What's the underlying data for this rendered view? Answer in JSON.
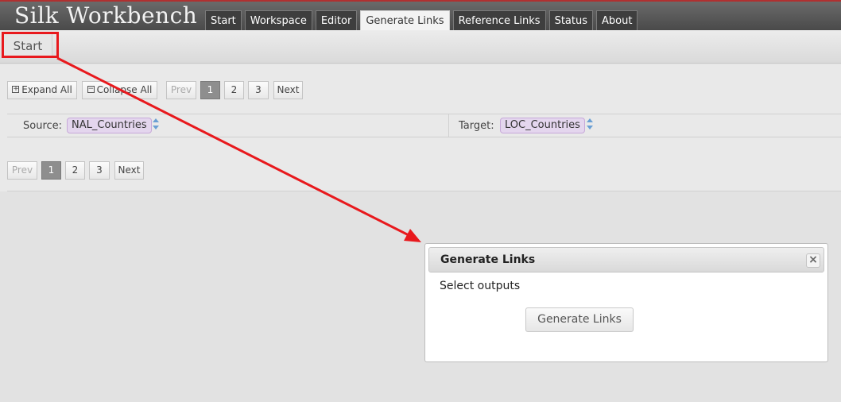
{
  "header": {
    "title": "Silk Workbench",
    "tabs": [
      "Start",
      "Workspace",
      "Editor",
      "Generate Links",
      "Reference Links",
      "Status",
      "About"
    ],
    "active_tab": "Generate Links"
  },
  "subbar": {
    "start_label": "Start"
  },
  "toolbar": {
    "expand_all": "Expand All",
    "collapse_all": "Collapse All",
    "prev": "Prev",
    "pages": [
      "1",
      "2",
      "3"
    ],
    "next": "Next",
    "current_page": "1"
  },
  "source": {
    "label": "Source:",
    "value": "NAL_Countries"
  },
  "target": {
    "label": "Target:",
    "value": "LOC_Countries"
  },
  "dialog": {
    "title": "Generate Links",
    "close_label": "×",
    "text": "Select outputs",
    "button": "Generate Links"
  },
  "colors": {
    "highlight": "#e8191d",
    "header_accent": "#b03030",
    "pill_bg": "#e4d6ee"
  }
}
